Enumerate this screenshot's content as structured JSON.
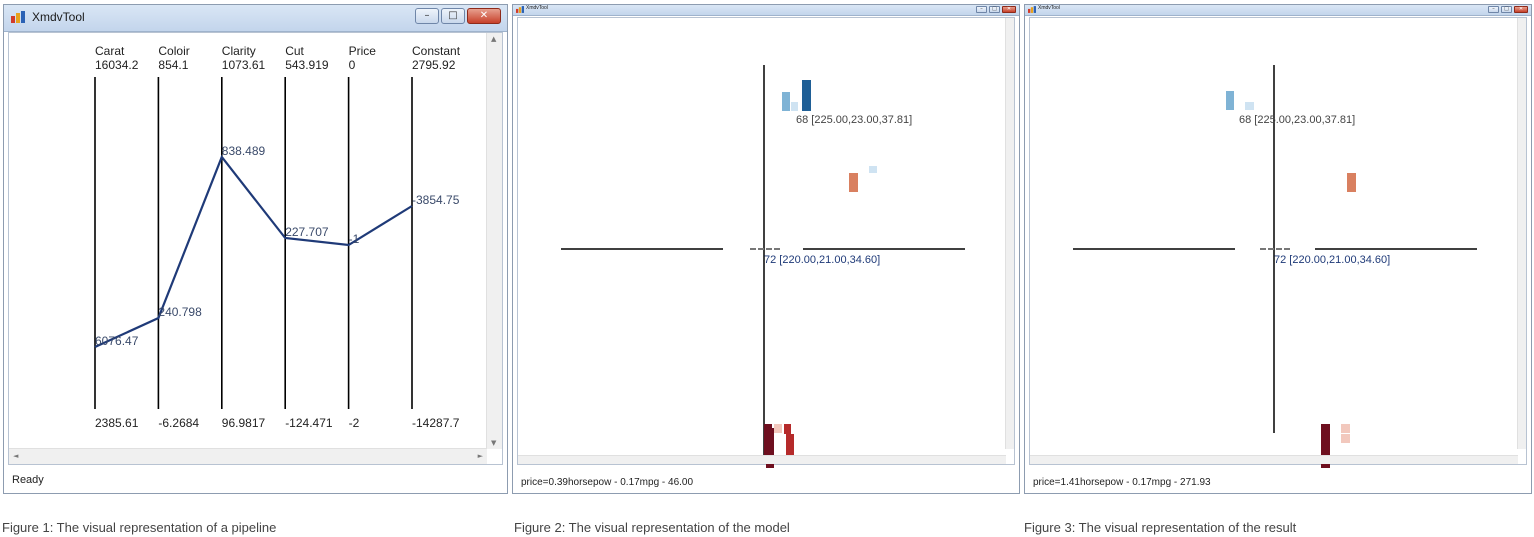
{
  "windows": {
    "main": {
      "title": "XmdvTool",
      "status": "Ready",
      "axes": [
        {
          "name": "Carat",
          "max": "16034.2",
          "min": "2385.61",
          "value_label": "6076.47"
        },
        {
          "name": "Coloir",
          "max": "854.1",
          "min": "-6.2684",
          "value_label": "240.798"
        },
        {
          "name": "Clarity",
          "max": "1073.61",
          "min": "96.9817",
          "value_label": "838.489"
        },
        {
          "name": "Cut",
          "max": "543.919",
          "min": "-124.471",
          "value_label": "227.707"
        },
        {
          "name": "Price",
          "max": "0",
          "min": "-2",
          "value_label": "-1"
        },
        {
          "name": "Constant",
          "max": "2795.92",
          "min": "-14287.7",
          "value_label": "-3854.75"
        }
      ],
      "line_color": "#1f3a78"
    },
    "view2": {
      "title": "XmdvTool",
      "status": "price=0.39horsepow - 0.17mpg - 46.00",
      "label_top": "68 [225.00,23.00,37.81]",
      "label_mid": "72 [220.00,21.00,34.60]"
    },
    "view3": {
      "title": "XmdvTool",
      "status": "price=1.41horsepow - 0.17mpg - 271.93",
      "label_top": "68 [225.00,23.00,37.81]",
      "label_mid": "72 [220.00,21.00,34.60]"
    }
  },
  "icons": {
    "minimize": "–",
    "maximize": "□",
    "close": "✕",
    "scroll_up": "▲",
    "scroll_down": "▼",
    "scroll_left": "◄",
    "scroll_right": "►"
  },
  "captions": [
    "Figure 1: The visual representation of a pipeline",
    "Figure 2: The visual representation of the model",
    "Figure 3: The visual representation of the result"
  ],
  "colors": {
    "blue_light": "#7fb3d5",
    "blue_dark": "#1f5f96",
    "blue_pale": "#cfe3f2",
    "salmon": "#d98060",
    "red_dark": "#6e0f1f",
    "red": "#b52a2a",
    "pink_pale": "#f2c8bd"
  }
}
